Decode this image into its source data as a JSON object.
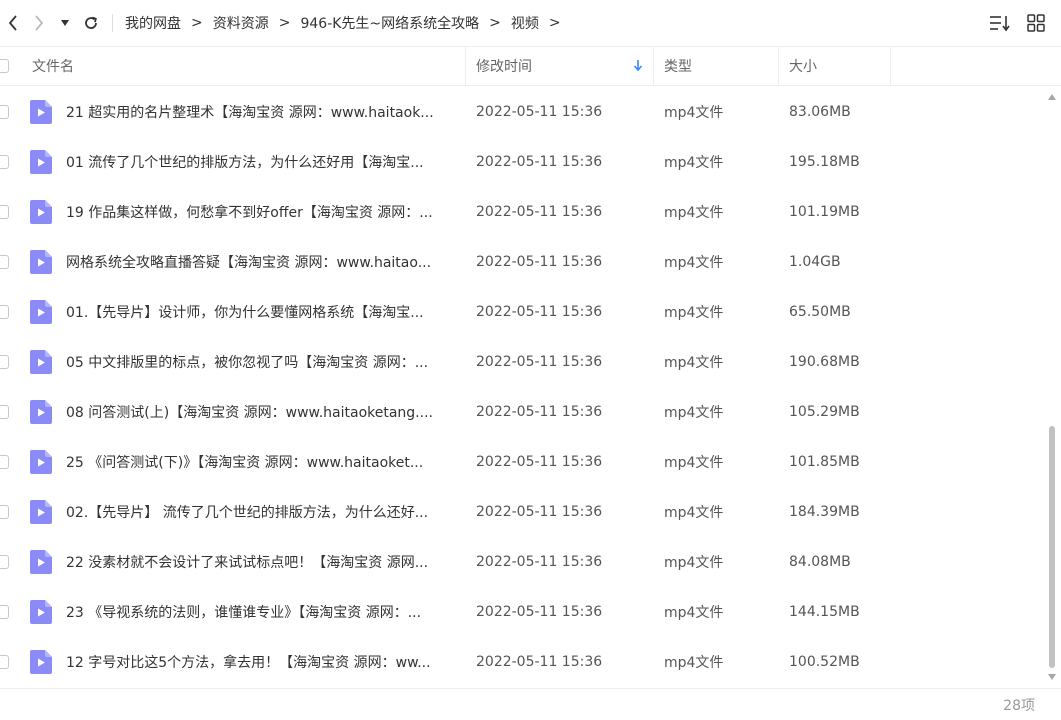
{
  "nav": {
    "back_icon": "chevron-left-icon",
    "forward_icon": "chevron-right-icon",
    "dropdown_icon": "caret-down-icon",
    "refresh_icon": "refresh-icon"
  },
  "breadcrumb": [
    "我的网盘",
    "资料资源",
    "946-K先生~网络系统全攻略",
    "视频"
  ],
  "breadcrumb_sep": ">",
  "toolbar": {
    "sort_icon": "sort-list-icon",
    "view_icon": "grid-view-icon"
  },
  "columns": {
    "name": "文件名",
    "time": "修改时间",
    "type": "类型",
    "size": "大小"
  },
  "files": [
    {
      "name": "21 超实用的名片整理术【海淘宝资 源网：www.haitaok...",
      "time": "2022-05-11 15:36",
      "type": "mp4文件",
      "size": "83.06MB"
    },
    {
      "name": "01 流传了几个世纪的排版方法，为什么还好用【海淘宝...",
      "time": "2022-05-11 15:36",
      "type": "mp4文件",
      "size": "195.18MB"
    },
    {
      "name": "19 作品集这样做，何愁拿不到好offer【海淘宝资 源网：...",
      "time": "2022-05-11 15:36",
      "type": "mp4文件",
      "size": "101.19MB"
    },
    {
      "name": "网格系统全攻略直播答疑【海淘宝资 源网：www.haitao...",
      "time": "2022-05-11 15:36",
      "type": "mp4文件",
      "size": "1.04GB"
    },
    {
      "name": "01.【先导片】设计师，你为什么要懂网格系统【海淘宝...",
      "time": "2022-05-11 15:36",
      "type": "mp4文件",
      "size": "65.50MB"
    },
    {
      "name": "05 中文排版里的标点，被你忽视了吗【海淘宝资 源网：...",
      "time": "2022-05-11 15:36",
      "type": "mp4文件",
      "size": "190.68MB"
    },
    {
      "name": "08 问答测试(上)【海淘宝资 源网：www.haitaoketang....",
      "time": "2022-05-11 15:36",
      "type": "mp4文件",
      "size": "105.29MB"
    },
    {
      "name": "25 《问答测试(下)》【海淘宝资 源网：www.haitaoket...",
      "time": "2022-05-11 15:36",
      "type": "mp4文件",
      "size": "101.85MB"
    },
    {
      "name": "02.【先导片】 流传了几个世纪的排版方法，为什么还好...",
      "time": "2022-05-11 15:36",
      "type": "mp4文件",
      "size": "184.39MB"
    },
    {
      "name": "22 没素材就不会设计了来试试标点吧！【海淘宝资 源网...",
      "time": "2022-05-11 15:36",
      "type": "mp4文件",
      "size": "84.08MB"
    },
    {
      "name": "23 《导视系统的法则，谁懂谁专业》【海淘宝资 源网：...",
      "time": "2022-05-11 15:36",
      "type": "mp4文件",
      "size": "144.15MB"
    },
    {
      "name": "12 字号对比这5个方法，拿去用！【海淘宝资 源网：ww...",
      "time": "2022-05-11 15:36",
      "type": "mp4文件",
      "size": "100.52MB"
    }
  ],
  "footer": {
    "count": "28项"
  },
  "colors": {
    "accent": "#3a85ff",
    "video_icon": "#8b8bf7"
  }
}
